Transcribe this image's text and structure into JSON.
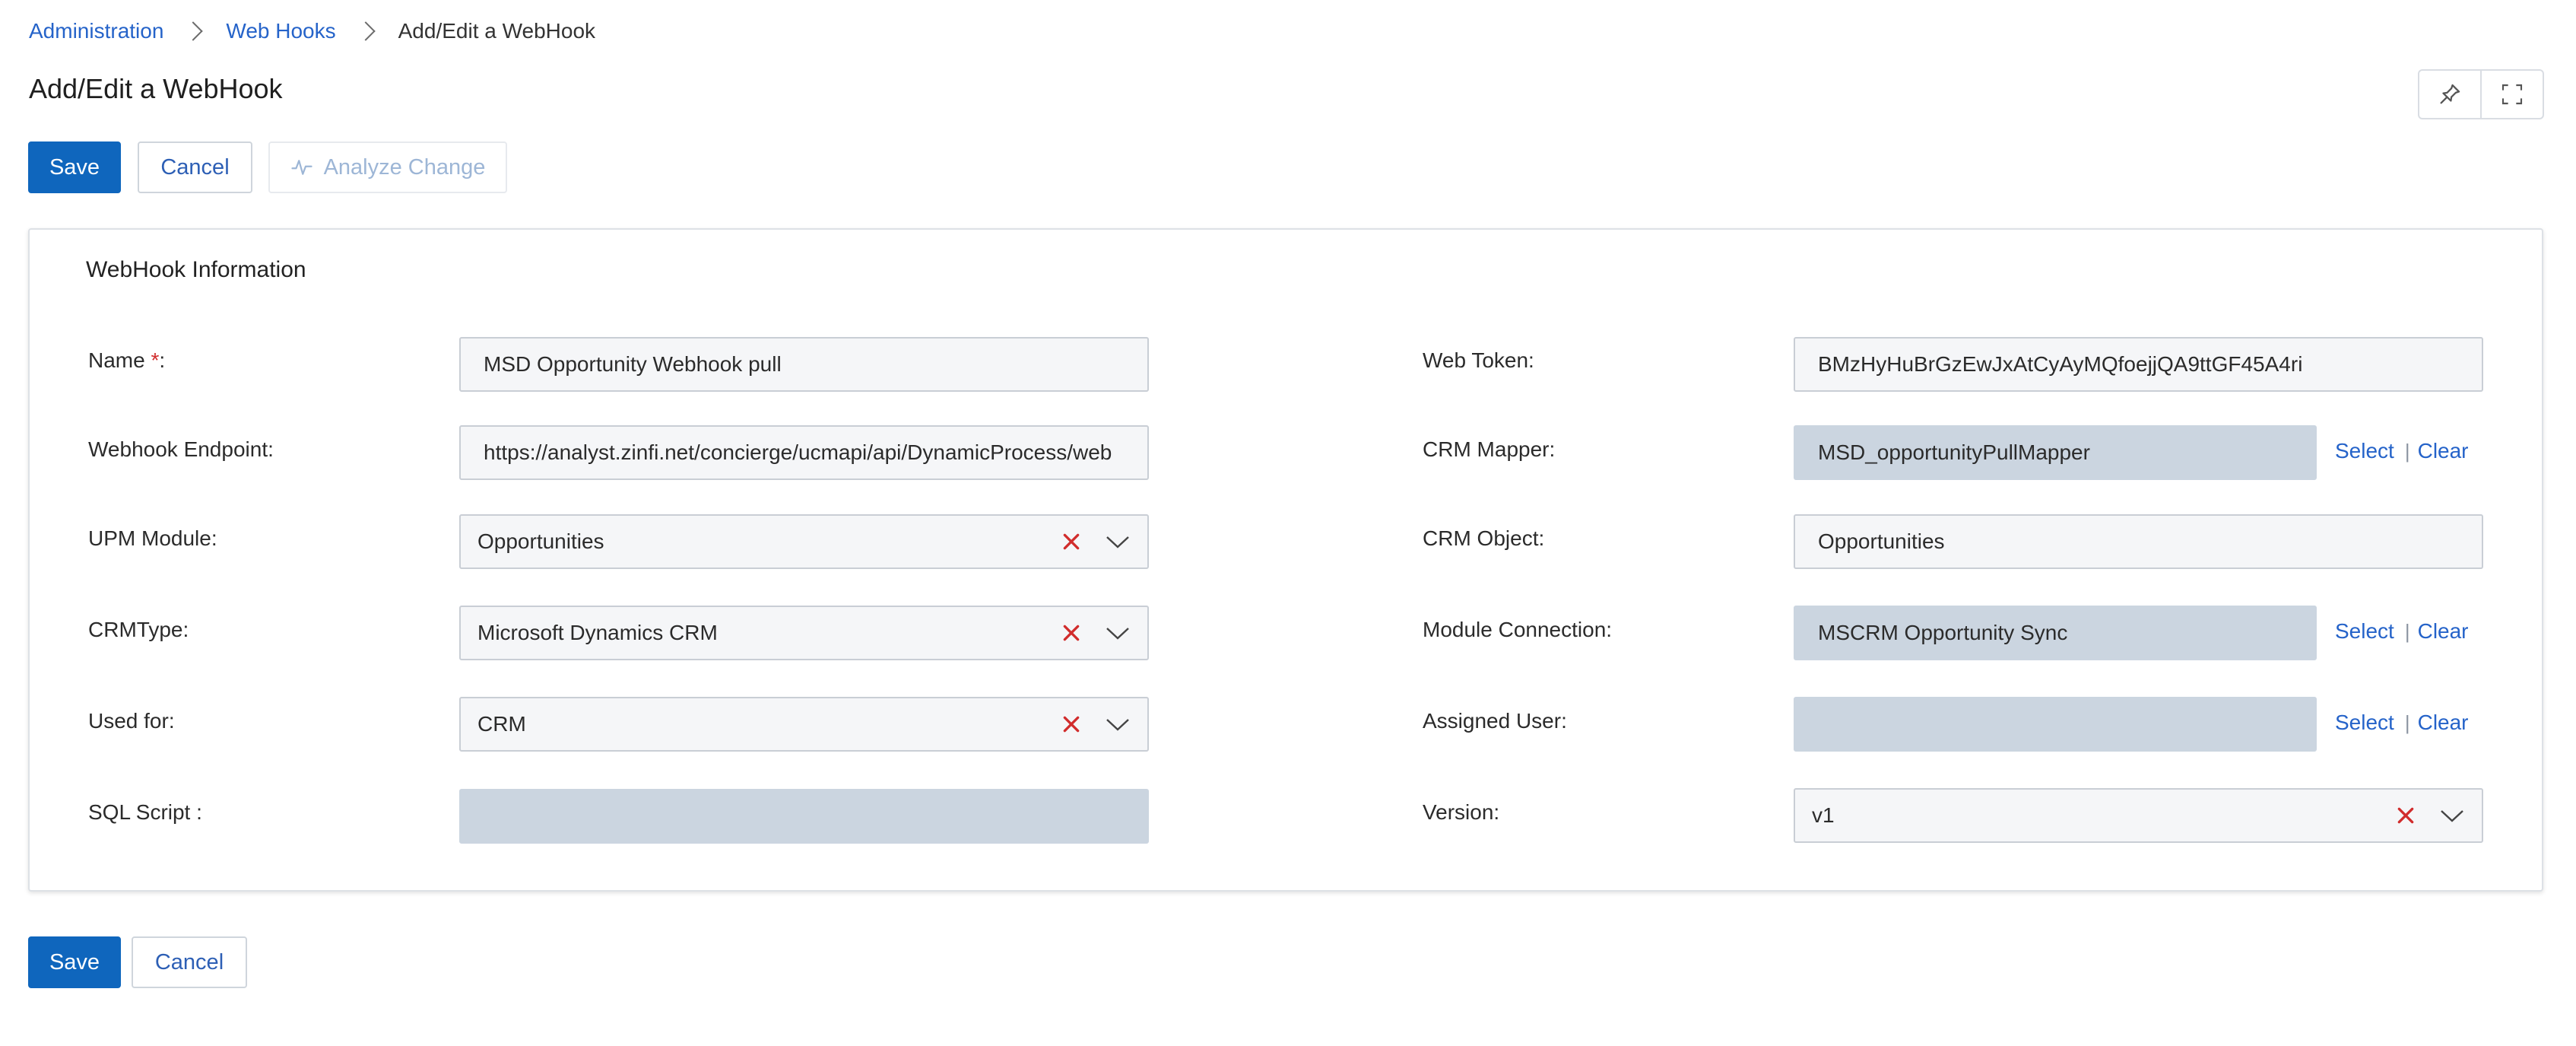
{
  "breadcrumb": {
    "items": [
      "Administration",
      "Web Hooks"
    ],
    "current": "Add/Edit a WebHook"
  },
  "page": {
    "title": "Add/Edit a WebHook"
  },
  "toolbar": {
    "save_label": "Save",
    "cancel_label": "Cancel",
    "analyze_label": "Analyze Change"
  },
  "section": {
    "title": "WebHook Information"
  },
  "form": {
    "name": {
      "label": "Name",
      "required_mark": "*",
      "suffix": ":",
      "value": "MSD Opportunity Webhook pull"
    },
    "webhook_endpoint": {
      "label": "Webhook Endpoint:",
      "value": "https://analyst.zinfi.net/concierge/ucmapi/api/DynamicProcess/web"
    },
    "upm_module": {
      "label": "UPM Module:",
      "value": "Opportunities"
    },
    "crm_type": {
      "label": "CRMType:",
      "value": "Microsoft Dynamics CRM"
    },
    "used_for": {
      "label": "Used for:",
      "value": "CRM"
    },
    "sql_script": {
      "label": "SQL Script :",
      "value": ""
    },
    "web_token": {
      "label": "Web Token:",
      "value": "BMzHyHuBrGzEwJxAtCyAyMQfoejjQA9ttGF45A4ri"
    },
    "crm_mapper": {
      "label": "CRM Mapper:",
      "value": "MSD_opportunityPullMapper"
    },
    "crm_object": {
      "label": "CRM Object:",
      "value": "Opportunities"
    },
    "module_connection": {
      "label": "Module Connection:",
      "value": "MSCRM Opportunity Sync"
    },
    "assigned_user": {
      "label": "Assigned User:",
      "value": ""
    },
    "version": {
      "label": "Version:",
      "value": "v1"
    }
  },
  "links": {
    "select": "Select",
    "separator": "|",
    "clear": "Clear"
  },
  "footer": {
    "save_label": "Save",
    "cancel_label": "Cancel"
  },
  "icons": {
    "breadcrumb_separator": "chevron-right-icon",
    "pin": "pin-icon",
    "fullscreen": "fullscreen-icon",
    "analyze": "activity-icon",
    "clear_select": "close-icon",
    "dropdown": "chevron-down-icon"
  },
  "colors": {
    "primary": "#0f66bd",
    "link": "#2563c9",
    "clear_x": "#d12c2c",
    "readonly_field": "#cbd5e0"
  }
}
